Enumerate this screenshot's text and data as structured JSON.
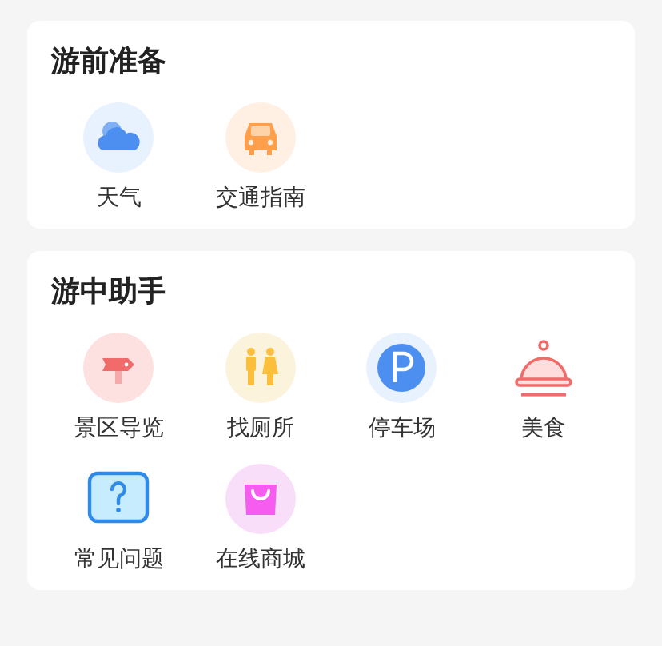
{
  "sections": [
    {
      "title": "游前准备",
      "items": [
        {
          "kind": "weather",
          "label": "天气"
        },
        {
          "kind": "car",
          "label": "交通指南"
        }
      ]
    },
    {
      "title": "游中助手",
      "items": [
        {
          "kind": "signpost",
          "label": "景区导览"
        },
        {
          "kind": "toilet",
          "label": "找厕所"
        },
        {
          "kind": "parking",
          "label": "停车场"
        },
        {
          "kind": "food",
          "label": "美食"
        },
        {
          "kind": "faq",
          "label": "常见问题"
        },
        {
          "kind": "shop",
          "label": "在线商城"
        }
      ]
    }
  ]
}
